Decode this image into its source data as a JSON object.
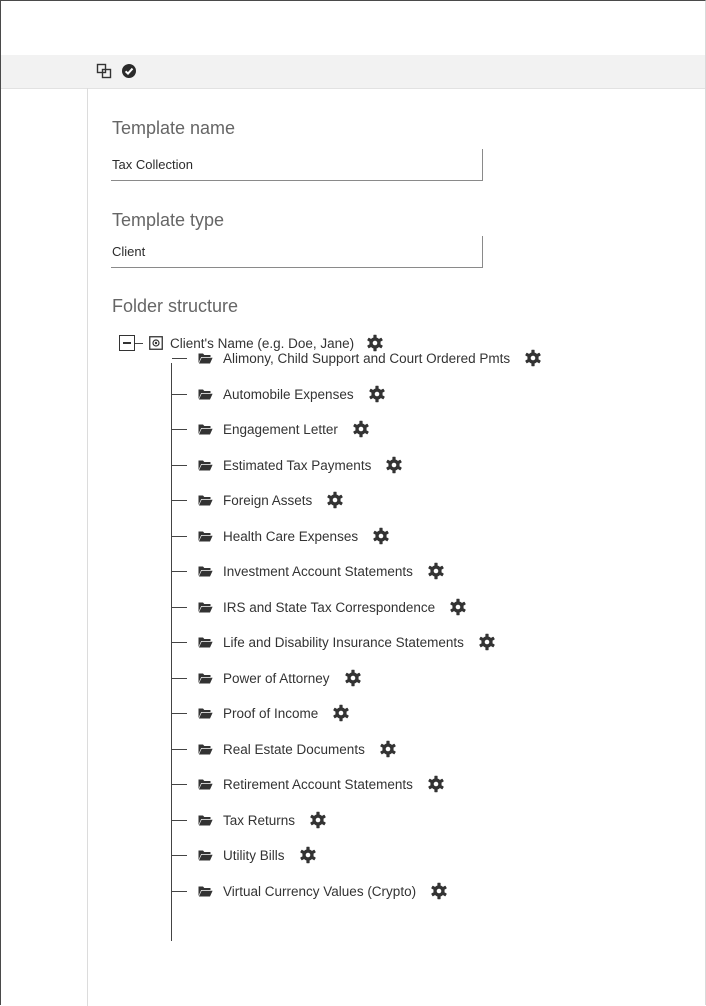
{
  "toolbar": {
    "icons": [
      "copy-icon",
      "check-circle-icon"
    ]
  },
  "form": {
    "template_name_label": "Template name",
    "template_name_value": "Tax Collection",
    "template_type_label": "Template type",
    "template_type_value": "Client",
    "folder_structure_label": "Folder structure"
  },
  "tree": {
    "root": {
      "label": "Client's Name (e.g. Doe, Jane)",
      "icon": "client-folder-icon",
      "expanded": true
    },
    "children": [
      {
        "label": "Alimony, Child Support and Court Ordered Pmts"
      },
      {
        "label": "Automobile Expenses"
      },
      {
        "label": "Engagement Letter"
      },
      {
        "label": "Estimated Tax Payments"
      },
      {
        "label": "Foreign Assets"
      },
      {
        "label": "Health Care Expenses"
      },
      {
        "label": "Investment Account Statements"
      },
      {
        "label": "IRS and State Tax Correspondence"
      },
      {
        "label": "Life and Disability Insurance Statements"
      },
      {
        "label": "Power of Attorney"
      },
      {
        "label": "Proof of Income"
      },
      {
        "label": "Real Estate Documents"
      },
      {
        "label": "Retirement Account Statements"
      },
      {
        "label": "Tax Returns"
      },
      {
        "label": "Utility Bills"
      },
      {
        "label": "Virtual Currency Values (Crypto)"
      }
    ]
  },
  "colors": {
    "toolbar_bg": "#f2f2f2",
    "label_text": "#666666",
    "tree_line": "#444444"
  }
}
